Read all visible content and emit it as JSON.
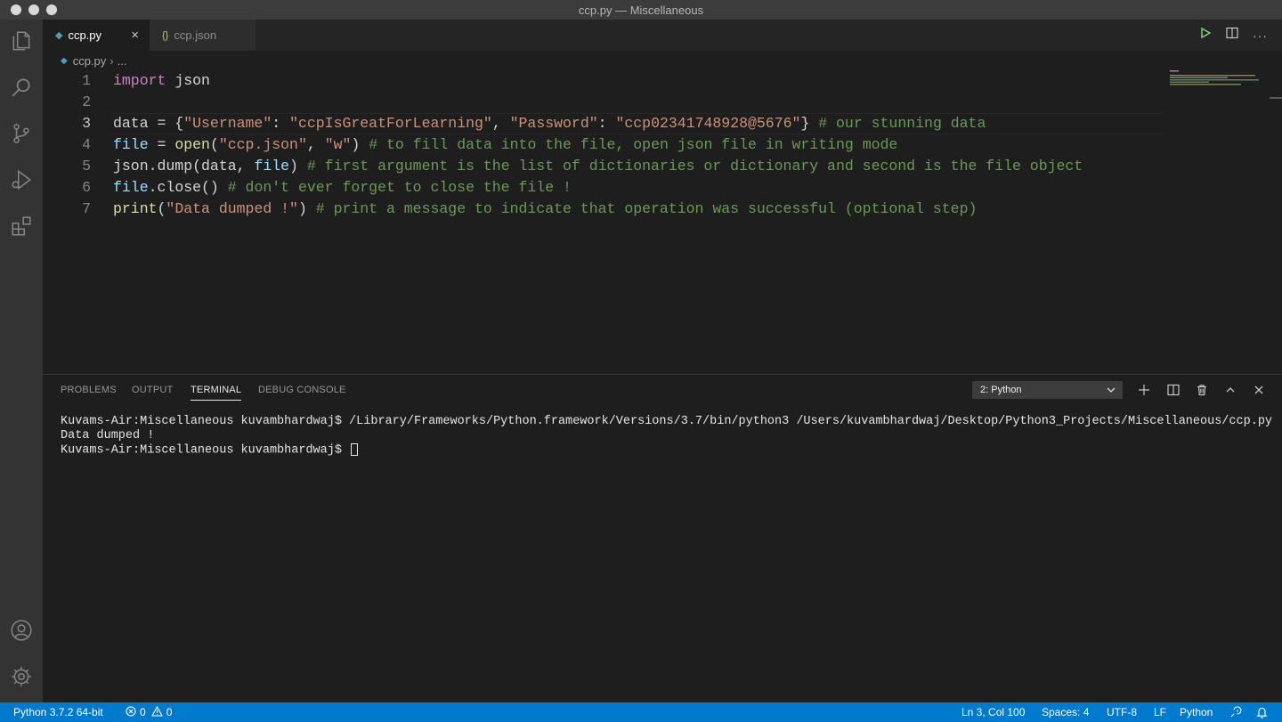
{
  "window": {
    "title": "ccp.py — Miscellaneous"
  },
  "tabs": [
    {
      "label": "ccp.py",
      "icon": "python-file-icon",
      "close": "×"
    },
    {
      "label": "ccp.json",
      "icon": "json-file-icon",
      "icon_glyph": "{}"
    }
  ],
  "breadcrumb": {
    "file": "ccp.py",
    "rest": "..."
  },
  "editor": {
    "line_numbers": [
      "1",
      "2",
      "3",
      "4",
      "5",
      "6",
      "7"
    ],
    "current_line": 3,
    "lines": [
      [
        {
          "t": "import",
          "c": "kw"
        },
        {
          "t": " json",
          "c": "pl"
        }
      ],
      [],
      [
        {
          "t": "data = {",
          "c": "pl"
        },
        {
          "t": "\"Username\"",
          "c": "str"
        },
        {
          "t": ": ",
          "c": "pl"
        },
        {
          "t": "\"ccpIsGreatForLearning\"",
          "c": "str"
        },
        {
          "t": ", ",
          "c": "pl"
        },
        {
          "t": "\"Password\"",
          "c": "str"
        },
        {
          "t": ": ",
          "c": "pl"
        },
        {
          "t": "\"ccp02341748928@5676\"",
          "c": "str"
        },
        {
          "t": "} ",
          "c": "pl"
        },
        {
          "t": "# our stunning data",
          "c": "com"
        }
      ],
      [
        {
          "t": "file",
          "c": "var"
        },
        {
          "t": " = ",
          "c": "pl"
        },
        {
          "t": "open",
          "c": "fn"
        },
        {
          "t": "(",
          "c": "pl"
        },
        {
          "t": "\"ccp.json\"",
          "c": "str"
        },
        {
          "t": ", ",
          "c": "pl"
        },
        {
          "t": "\"w\"",
          "c": "str"
        },
        {
          "t": ") ",
          "c": "pl"
        },
        {
          "t": "# to fill data into the file, open json file in writing mode",
          "c": "com"
        }
      ],
      [
        {
          "t": "json.dump(data, ",
          "c": "pl"
        },
        {
          "t": "file",
          "c": "var"
        },
        {
          "t": ") ",
          "c": "pl"
        },
        {
          "t": "# first argument is the list of dictionaries or dictionary and second is the file object",
          "c": "com"
        }
      ],
      [
        {
          "t": "file",
          "c": "var"
        },
        {
          "t": ".close() ",
          "c": "pl"
        },
        {
          "t": "# don't ever forget to close the file !",
          "c": "com"
        }
      ],
      [
        {
          "t": "print",
          "c": "fn"
        },
        {
          "t": "(",
          "c": "pl"
        },
        {
          "t": "\"Data dumped !\"",
          "c": "str"
        },
        {
          "t": ") ",
          "c": "pl"
        },
        {
          "t": "# print a message to indicate that operation was successful (optional step)",
          "c": "com"
        }
      ]
    ]
  },
  "panel": {
    "tabs": [
      "PROBLEMS",
      "OUTPUT",
      "TERMINAL",
      "DEBUG CONSOLE"
    ],
    "active_tab": "TERMINAL",
    "terminal_select": "2: Python",
    "terminal_lines": [
      "Kuvams-Air:Miscellaneous kuvambhardwaj$ /Library/Frameworks/Python.framework/Versions/3.7/bin/python3 /Users/kuvambhardwaj/Desktop/Python3_Projects/Miscellaneous/ccp.py",
      "Data dumped !",
      "Kuvams-Air:Miscellaneous kuvambhardwaj$ "
    ]
  },
  "status": {
    "interpreter": "Python 3.7.2 64-bit",
    "errors": "0",
    "warnings": "0",
    "position": "Ln 3, Col 100",
    "spaces": "Spaces: 4",
    "encoding": "UTF-8",
    "eol": "LF",
    "language": "Python"
  },
  "colors": {
    "accent": "#007acc",
    "keyword": "#c586c0",
    "string": "#ce9178",
    "comment": "#6a9955",
    "function": "#dcdcaa",
    "variable": "#9cdcfe"
  }
}
